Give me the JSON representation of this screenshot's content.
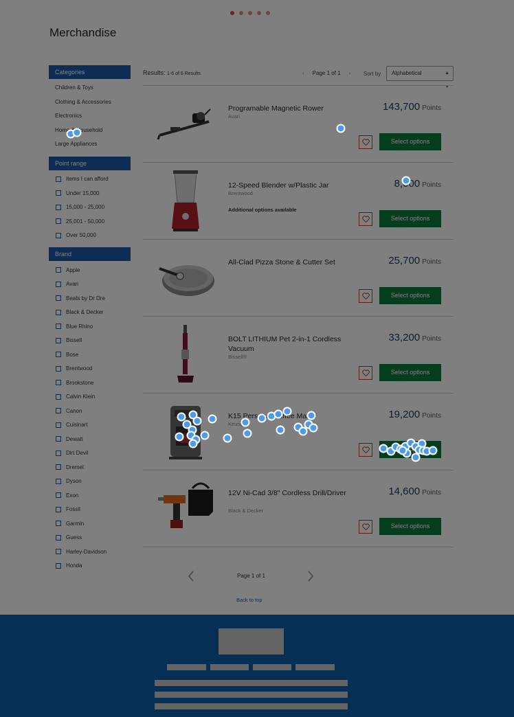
{
  "carousel": {
    "count": 5,
    "active": 0
  },
  "page_title": "Merchandise",
  "sidebar": {
    "categories_heading": "Categories",
    "categories": [
      "Children & Toys",
      "Clothing & Accessories",
      "Electronics",
      "Home & Household",
      "Large Appliances"
    ],
    "point_range_heading": "Point range",
    "point_ranges": [
      "Items I can afford",
      "Under 15,000",
      "15,000 - 25,000",
      "25,001 - 50,000",
      "Over 50,000"
    ],
    "brand_heading": "Brand",
    "brands": [
      "Apple",
      "Avari",
      "Beats by Dr Dre",
      "Black & Decker",
      "Blue Rhino",
      "Bissell",
      "Bose",
      "Brentwood",
      "Brookstone",
      "Calvin Klein",
      "Canon",
      "Cuisinart",
      "Dewalt",
      "Dirt Devil",
      "Dremel",
      "Dyson",
      "Exon",
      "Fossil",
      "Garmin",
      "Guess",
      "Harley-Davidson",
      "Honda"
    ]
  },
  "results": {
    "label": "Results:",
    "count_text": "1-6 of 6 Results",
    "page_text": "Page 1 of 1",
    "sort_label": "Sort by",
    "sort_value": "Alphabetical"
  },
  "products": [
    {
      "name": "Programable Magnetic Rower",
      "brand": "Avari",
      "note": "",
      "points": "143,700",
      "unit": "Points",
      "button": "Select options",
      "image": "rower-image"
    },
    {
      "name": "12-Speed Blender w/Plastic Jar",
      "brand": "Brentwood",
      "note": "Additional options available",
      "points": "8,000",
      "unit": "Points",
      "button": "Select options",
      "image": "blender-image"
    },
    {
      "name": "All-Clad Pizza Stone & Cutter Set",
      "brand": "",
      "note": "",
      "points": "25,700",
      "unit": "Points",
      "button": "Select options",
      "image": "pizza-stone-image"
    },
    {
      "name": "BOLT LITHIUM Pet 2-in-1 Cordless Vacuum",
      "brand": "Bissell®",
      "note": "",
      "points": "33,200",
      "unit": "Points",
      "button": "Select options",
      "image": "vacuum-image"
    },
    {
      "name": "K15 Personal Coffee Maker",
      "brand": "Keurig",
      "note": "",
      "points": "19,200",
      "unit": "Points",
      "button": "Select options",
      "image": "coffee-maker-image"
    },
    {
      "name": "12V Ni-Cad 3/8\" Cordless Drill/Driver",
      "brand": "Black & Decker",
      "note": "",
      "points": "14,600",
      "unit": "Points",
      "button": "Select options",
      "image": "drill-image"
    }
  ],
  "bottom_pager": {
    "page_text": "Page 1 of 1"
  },
  "back_to_top": "Back to top",
  "colors": {
    "accent": "#1d5aa8",
    "button": "#0a7a3e",
    "heart": "#c0392b",
    "footer": "#0b5ea8"
  }
}
